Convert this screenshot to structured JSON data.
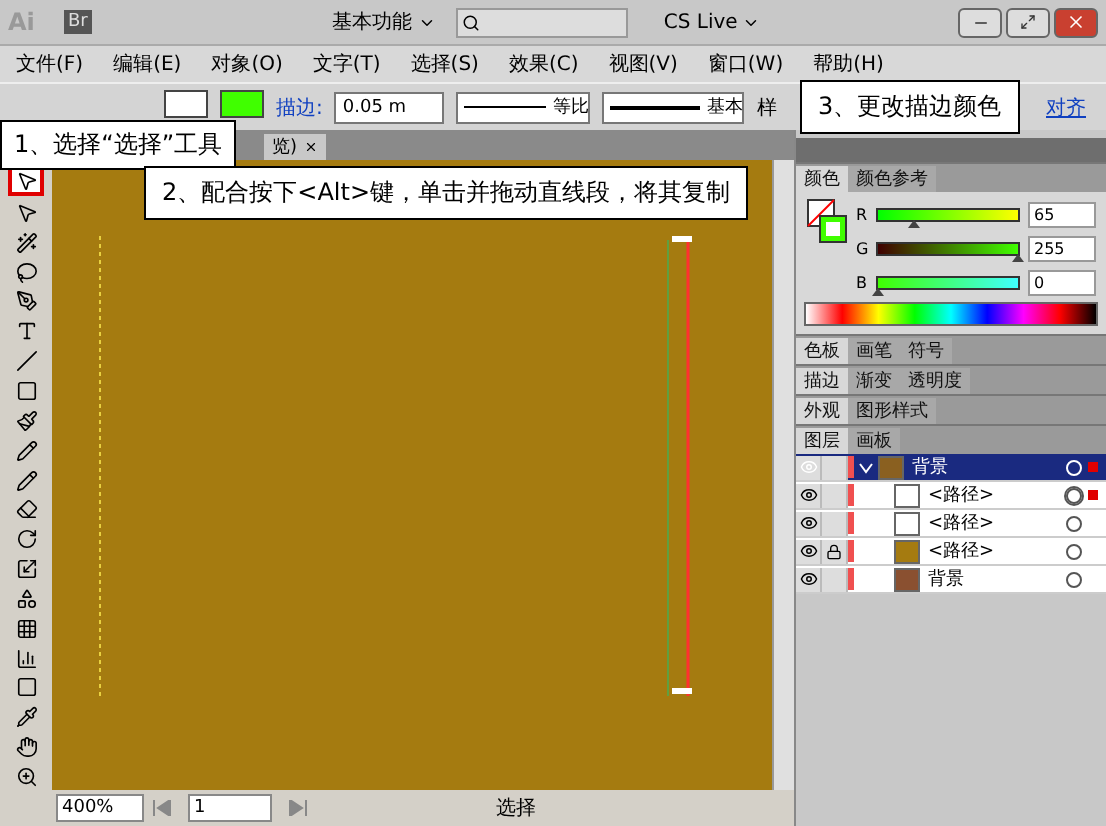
{
  "title_bar": {
    "logo": "Ai",
    "bridge": "Br",
    "workspace": "基本功能",
    "cs_live": "CS Live"
  },
  "menu": [
    "文件(F)",
    "编辑(E)",
    "对象(O)",
    "文字(T)",
    "选择(S)",
    "效果(C)",
    "视图(V)",
    "窗口(W)",
    "帮助(H)"
  ],
  "control_bar": {
    "stroke_label": "描边:",
    "stroke_weight": "0.05 m",
    "profile": "等比",
    "brush": "基本",
    "style_label": "样",
    "align_link": "对齐"
  },
  "document_tab": {
    "label": "览)"
  },
  "callouts": [
    "1、选择“选择”工具",
    "2、配合按下<Alt>键，单击并拖动直线段，将其复制",
    "3、更改描边颜色"
  ],
  "color_panel": {
    "tabs": [
      {
        "label": "颜色",
        "selected": true
      },
      {
        "label": "颜色参考",
        "selected": false
      }
    ],
    "channels": [
      {
        "name": "R",
        "level": 0.25,
        "value": "65"
      },
      {
        "name": "G",
        "level": 1,
        "value": "255"
      },
      {
        "name": "B",
        "level": 0,
        "value": "0"
      }
    ]
  },
  "panel_groups": [
    {
      "tabs": [
        {
          "label": "色板",
          "selected": true
        },
        {
          "label": "画笔",
          "selected": false
        },
        {
          "label": "符号",
          "selected": false
        }
      ]
    },
    {
      "tabs": [
        {
          "label": "描边",
          "selected": true
        },
        {
          "label": "渐变",
          "selected": false
        },
        {
          "label": "透明度",
          "selected": false
        }
      ]
    },
    {
      "tabs": [
        {
          "label": "外观",
          "selected": true
        },
        {
          "label": "图形样式",
          "selected": false
        }
      ]
    }
  ],
  "layers_panel": {
    "tabs": [
      {
        "label": "图层",
        "selected": true
      },
      {
        "label": "画板",
        "selected": false
      }
    ],
    "items": [
      {
        "name": "背景",
        "selected": true,
        "expanded": true,
        "locked": false,
        "targeted": false,
        "has_selection": true,
        "children": [
          {
            "name": "<路径>",
            "selected": false,
            "locked": false,
            "targeted": true,
            "has_selection": true
          },
          {
            "name": "<路径>",
            "selected": false,
            "locked": false,
            "targeted": false,
            "has_selection": false
          },
          {
            "name": "<路径>",
            "selected": false,
            "locked": true,
            "targeted": false,
            "has_selection": false
          },
          {
            "name": "背景",
            "selected": false,
            "locked": false,
            "targeted": false,
            "has_selection": false
          }
        ]
      }
    ]
  },
  "status_bar": {
    "zoom": "400%",
    "artboard": "1",
    "tool": "选择"
  }
}
